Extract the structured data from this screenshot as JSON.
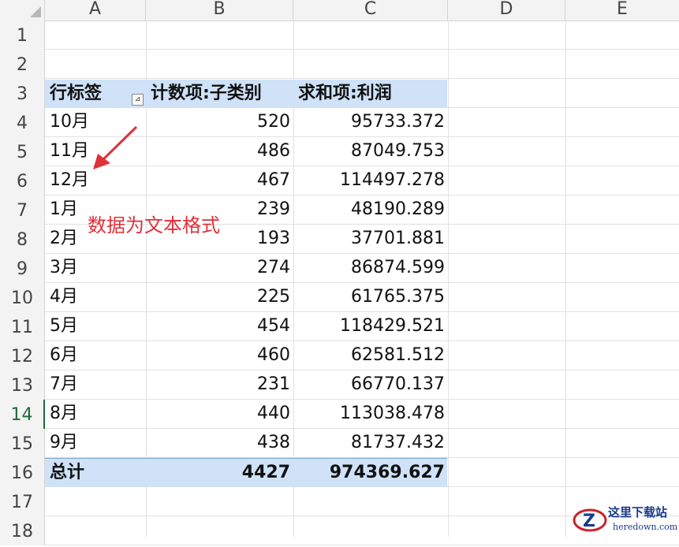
{
  "columns": [
    "A",
    "B",
    "C",
    "D",
    "E"
  ],
  "rows": [
    "1",
    "2",
    "3",
    "4",
    "5",
    "6",
    "7",
    "8",
    "9",
    "10",
    "11",
    "12",
    "13",
    "14",
    "15",
    "16",
    "17",
    "18"
  ],
  "pivot": {
    "headers": {
      "row_label": "行标签",
      "count": "计数项:子类别",
      "sum": "求和项:利润"
    },
    "rows": [
      {
        "label": "10月",
        "count": "520",
        "sum": "95733.372"
      },
      {
        "label": "11月",
        "count": "486",
        "sum": "87049.753"
      },
      {
        "label": "12月",
        "count": "467",
        "sum": "114497.278"
      },
      {
        "label": "1月",
        "count": "239",
        "sum": "48190.289"
      },
      {
        "label": "2月",
        "count": "193",
        "sum": "37701.881"
      },
      {
        "label": "3月",
        "count": "274",
        "sum": "86874.599"
      },
      {
        "label": "4月",
        "count": "225",
        "sum": "61765.375"
      },
      {
        "label": "5月",
        "count": "454",
        "sum": "118429.521"
      },
      {
        "label": "6月",
        "count": "460",
        "sum": "62581.512"
      },
      {
        "label": "7月",
        "count": "231",
        "sum": "66770.137"
      },
      {
        "label": "8月",
        "count": "440",
        "sum": "113038.478"
      },
      {
        "label": "9月",
        "count": "438",
        "sum": "81737.432"
      }
    ],
    "total": {
      "label": "总计",
      "count": "4427",
      "sum": "974369.627"
    }
  },
  "annotation": {
    "text": "数据为文本格式",
    "color": "#e0303a"
  },
  "watermark": {
    "title": "这里下载站",
    "url": "heredown.com"
  },
  "colors": {
    "pivot_header_band": "#cfe2f7",
    "active_row": "#1e6b3a"
  }
}
